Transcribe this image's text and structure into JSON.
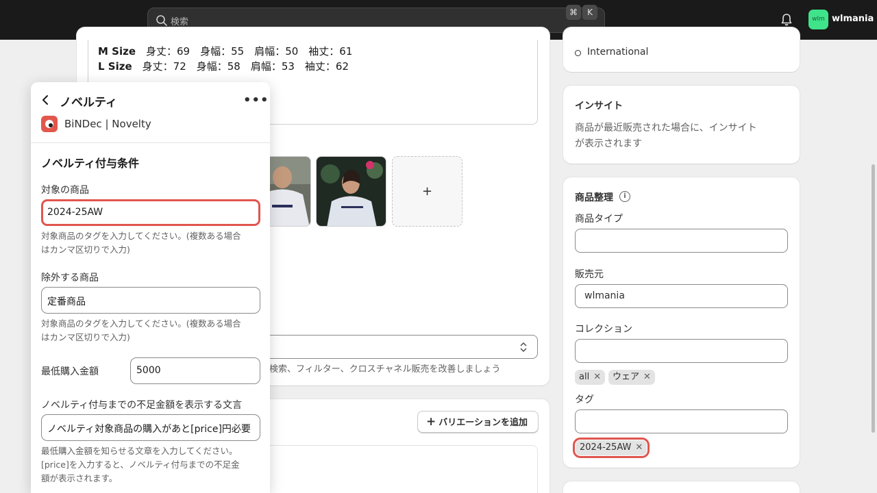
{
  "topbar": {
    "search_placeholder": "検索",
    "shortcut_cmd": "⌘",
    "shortcut_key": "K",
    "avatar_initials": "wlm",
    "store_name": "wlmania"
  },
  "description": {
    "rows": [
      {
        "size": "M Size",
        "rest": "身丈：69　身幅：55　肩幅：50　袖丈：61"
      },
      {
        "size": "L Size",
        "rest": "身丈：72　身幅：58　肩幅：53　袖丈：62"
      }
    ]
  },
  "media": {
    "add_label": "+"
  },
  "category": {
    "help": "検索、フィルター、クロスチャネル販売を改善しましょう"
  },
  "variants": {
    "add_button": "バリエーションを追加"
  },
  "markets": {
    "international": "International"
  },
  "insights": {
    "title": "インサイト",
    "line1": "商品が最近販売された場合に、インサイト",
    "line2": "が表示されます"
  },
  "organization": {
    "title": "商品整理",
    "product_type_label": "商品タイプ",
    "product_type_value": "",
    "vendor_label": "販売元",
    "vendor_value": "wlmania",
    "collections_label": "コレクション",
    "collections": [
      "all",
      "ウェア"
    ],
    "tags_label": "タグ",
    "tags": [
      "2024-25AW"
    ]
  },
  "panel": {
    "title": "ノベルティ",
    "more": "•••",
    "app_name": "BiNDec | Novelty",
    "section_title": "ノベルティ付与条件",
    "target_label": "対象の商品",
    "target_value": "2024-25AW",
    "target_help1": "対象商品のタグを入力してください。(複数ある場合",
    "target_help2": "はカンマ区切りで入力)",
    "exclude_label": "除外する商品",
    "exclude_value": "定番商品",
    "exclude_help1": "対象商品のタグを入力してください。(複数ある場合",
    "exclude_help2": "はカンマ区切りで入力)",
    "min_label": "最低購入金額",
    "min_value": "5000",
    "msg_label": "ノベルティ付与までの不足金額を表示する文言",
    "msg_value": "ノベルティ対象商品の購入があと[price]円必要",
    "msg_help1": "最低購入金額を知らせる文章を入力してください。",
    "msg_help2": "[price]を入力すると、ノベルティ付与までの不足金",
    "msg_help3": "額が表示されます。"
  },
  "colors": {
    "highlight": "#e0554f",
    "topbar": "#1a1a1a",
    "avatar": "#3fe38a",
    "app_icon": "#e2574c"
  }
}
